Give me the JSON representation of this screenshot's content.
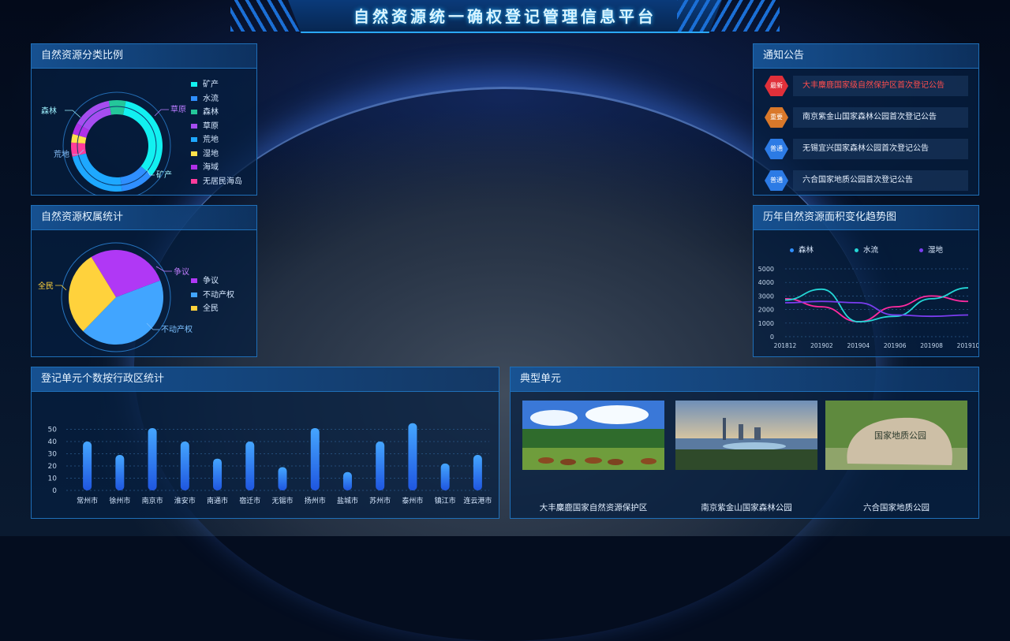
{
  "header": {
    "title": "自然资源统一确权登记管理信息平台"
  },
  "panels": {
    "classification": {
      "title": "自然资源分类比例",
      "callouts": [
        "森林",
        "草原",
        "荒地",
        "矿产"
      ],
      "legend": [
        {
          "label": "矿产",
          "color": "#12f0f0"
        },
        {
          "label": "水流",
          "color": "#2f8fff"
        },
        {
          "label": "森林",
          "color": "#24c79a"
        },
        {
          "label": "草原",
          "color": "#a64df0"
        },
        {
          "label": "荒地",
          "color": "#1ea8ff"
        },
        {
          "label": "湿地",
          "color": "#ffe14a"
        },
        {
          "label": "海域",
          "color": "#b030e8"
        },
        {
          "label": "无居民海岛",
          "color": "#ff3c9c"
        }
      ],
      "chart_data": {
        "type": "pie",
        "categories": [
          "矿产",
          "水流",
          "森林",
          "草原",
          "荒地",
          "湿地",
          "海域",
          "无居民海岛"
        ],
        "values": [
          33,
          12,
          6,
          14,
          23,
          3,
          4,
          5
        ]
      }
    },
    "ownership": {
      "title": "自然资源权属统计",
      "callouts": [
        "争议",
        "不动产权",
        "全民"
      ],
      "legend": [
        {
          "label": "争议",
          "color": "#b038f5"
        },
        {
          "label": "不动产权",
          "color": "#41a5ff"
        },
        {
          "label": "全民",
          "color": "#ffd23c"
        }
      ],
      "chart_data": {
        "type": "pie",
        "categories": [
          "争议",
          "不动产权",
          "全民"
        ],
        "values": [
          28,
          43,
          29
        ]
      }
    },
    "notices": {
      "title": "通知公告",
      "items": [
        {
          "tag": "最新",
          "text": "大丰麋鹿国家级自然保护区首次登记公告",
          "color": "#e0303a",
          "text_color": "#ff4d4d"
        },
        {
          "tag": "重要",
          "text": "南京紫金山国家森林公园首次登记公告",
          "color": "#d9782a",
          "text_color": "#e7f1ff"
        },
        {
          "tag": "普通",
          "text": "无锡宜兴国家森林公园首次登记公告",
          "color": "#2c7be5",
          "text_color": "#e7f1ff"
        },
        {
          "tag": "普通",
          "text": "六合国家地质公园首次登记公告",
          "color": "#2c7be5",
          "text_color": "#e7f1ff"
        }
      ]
    },
    "trend": {
      "title": "历年自然资源面积变化趋势图",
      "chart_data": {
        "type": "line",
        "x": [
          "201812",
          "201902",
          "201904",
          "201906",
          "201908",
          "201910"
        ],
        "ylim": [
          0,
          5000
        ],
        "yticks": [
          "5000",
          "4000",
          "3000",
          "2000",
          "1000",
          "0"
        ],
        "series": [
          {
            "name": "森林",
            "color": "#ff2aa0",
            "values": [
              2800,
              2200,
              1100,
              2200,
              3000,
              2600
            ]
          },
          {
            "name": "水流",
            "color": "#24d6d6",
            "values": [
              2700,
              3500,
              1100,
              1500,
              2800,
              3600
            ]
          },
          {
            "name": "湿地",
            "color": "#7b3df0",
            "values": [
              2500,
              2600,
              2500,
              1600,
              1500,
              1600
            ]
          }
        ]
      }
    },
    "registration": {
      "title": "登记单元个数按行政区统计",
      "chart_data": {
        "type": "bar",
        "categories": [
          "常州市",
          "徐州市",
          "南京市",
          "淮安市",
          "南通市",
          "宿迁市",
          "无锡市",
          "扬州市",
          "盐城市",
          "苏州市",
          "泰州市",
          "镇江市",
          "连云港市"
        ],
        "values": [
          40,
          29,
          51,
          40,
          26,
          40,
          19,
          51,
          15,
          40,
          55,
          22,
          29
        ],
        "ylim": [
          0,
          60
        ],
        "yticks": [
          "50",
          "40",
          "30",
          "20",
          "10",
          "0"
        ]
      }
    },
    "typical": {
      "title": "典型单元",
      "items": [
        {
          "caption": "大丰麋鹿国家自然资源保护区"
        },
        {
          "caption": "南京紫金山国家森林公园"
        },
        {
          "caption": "六合国家地质公园",
          "stone_text": "国家地质公园"
        }
      ]
    }
  }
}
